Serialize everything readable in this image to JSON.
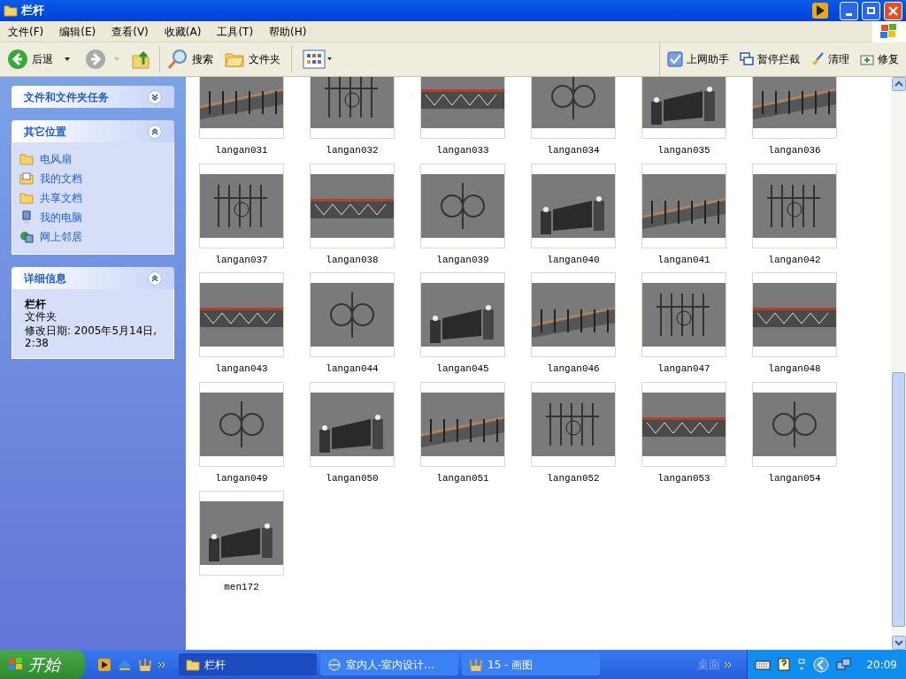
{
  "window": {
    "title": "栏杆"
  },
  "menu": [
    "文件(F)",
    "编辑(E)",
    "查看(V)",
    "收藏(A)",
    "工具(T)",
    "帮助(H)"
  ],
  "toolbar": {
    "back": "后退",
    "search": "搜索",
    "folders": "文件夹"
  },
  "addon_toolbar": [
    {
      "label": "上网助手",
      "kind": "helper"
    },
    {
      "label": "暂停拦截",
      "kind": "windows"
    },
    {
      "label": "清理",
      "kind": "broom"
    },
    {
      "label": "修复",
      "kind": "kit"
    }
  ],
  "sidebar": [
    {
      "title": "文件和文件夹任务",
      "expanded": false
    },
    {
      "title": "其它位置",
      "expanded": true,
      "items": [
        {
          "label": "电风扇",
          "kind": "folder"
        },
        {
          "label": "我的文档",
          "kind": "docs"
        },
        {
          "label": "共享文档",
          "kind": "folder"
        },
        {
          "label": "我的电脑",
          "kind": "computer"
        },
        {
          "label": "网上邻居",
          "kind": "network"
        }
      ]
    },
    {
      "title": "详细信息",
      "expanded": true,
      "details": {
        "name": "栏杆",
        "type": "文件夹",
        "modified": "修改日期: 2005年5月14日, 2:38"
      }
    }
  ],
  "files": [
    "langan031",
    "langan032",
    "langan033",
    "langan034",
    "langan035",
    "langan036",
    "langan037",
    "langan038",
    "langan039",
    "langan040",
    "langan041",
    "langan042",
    "langan043",
    "langan044",
    "langan045",
    "langan046",
    "langan047",
    "langan048",
    "langan049",
    "langan050",
    "langan051",
    "langan052",
    "langan053",
    "langan054",
    "men172"
  ],
  "taskbar": {
    "start": "开始",
    "tasks": [
      {
        "label": "栏杆",
        "kind": "folder",
        "selected": true
      },
      {
        "label": "室内人-室内设计...",
        "kind": "ie",
        "selected": false
      },
      {
        "label": "15 - 画图",
        "kind": "paint",
        "selected": false
      }
    ],
    "desktop": "桌面",
    "clock": "20:09"
  }
}
